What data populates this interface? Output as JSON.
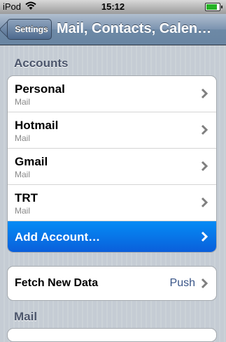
{
  "status": {
    "carrier": "iPod",
    "time": "15:12",
    "battery_level": 0.85
  },
  "nav": {
    "back_label": "Settings",
    "title": "Mail, Contacts, Calen…"
  },
  "sections": {
    "accounts_header": "Accounts",
    "mail_header": "Mail"
  },
  "accounts": [
    {
      "name": "Personal",
      "type": "Mail"
    },
    {
      "name": "Hotmail",
      "type": "Mail"
    },
    {
      "name": "Gmail",
      "type": "Mail"
    },
    {
      "name": "TRT",
      "type": "Mail"
    }
  ],
  "add_account_label": "Add Account…",
  "fetch": {
    "label": "Fetch New Data",
    "value": "Push"
  },
  "colors": {
    "highlight": "#0a6fe8",
    "value_text": "#385487"
  }
}
